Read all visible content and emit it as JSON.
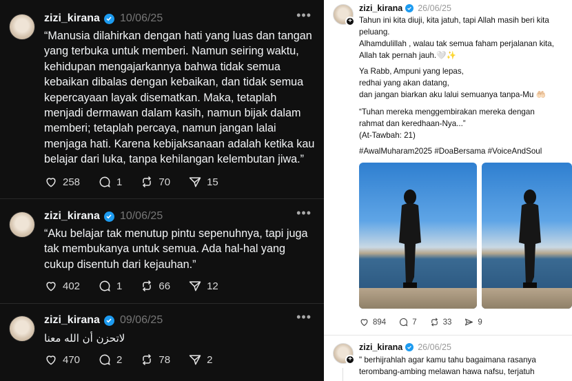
{
  "left_feed": {
    "posts": [
      {
        "username": "zizi_kirana",
        "date": "10/06/25",
        "text_lines": [
          "“Manusia dilahirkan dengan hati yang luas dan tangan",
          "yang terbuka untuk memberi. Namun seiring waktu,",
          "kehidupan mengajarkannya bahwa tidak semua",
          "kebaikan dibalas dengan kebaikan, dan tidak semua",
          "kepercayaan layak disematkan. Maka, tetaplah",
          "menjadi dermawan dalam kasih, namun bijak dalam",
          "memberi; tetaplah percaya, namun jangan lalai",
          "menjaga hati. Karena kebijaksanaan adalah ketika kau",
          "belajar dari luka, tanpa kehilangan kelembutan jiwa.”"
        ],
        "likes": "258",
        "replies": "1",
        "reposts": "70",
        "shares": "15"
      },
      {
        "username": "zizi_kirana",
        "date": "10/06/25",
        "text_lines": [
          "“Aku belajar tak menutup pintu sepenuhnya, tapi juga",
          "tak membukanya untuk semua. Ada hal-hal yang",
          "cukup disentuh dari kejauhan.”"
        ],
        "likes": "402",
        "replies": "1",
        "reposts": "66",
        "shares": "12"
      },
      {
        "username": "zizi_kirana",
        "date": "09/06/25",
        "text_lines": [
          "لاتحزن أن الله معنا"
        ],
        "likes": "470",
        "replies": "2",
        "reposts": "78",
        "shares": "2"
      }
    ],
    "more_glyph": "•••"
  },
  "right_feed": {
    "posts": [
      {
        "username": "zizi_kirana",
        "date": "26/06/25",
        "paragraphs": [
          "Tahun ini kita diuji, kita jatuh, tapi Allah masih beri kita peluang.",
          "Alhamdulillah , walau tak semua faham perjalanan kita, Allah tak pernah jauh.🤍✨",
          "Ya Rabb, Ampuni yang lepas,\nredhai yang akan datang,\ndan jangan biarkan aku lalui semuanya tanpa-Mu 🤲🏻",
          "“Tuhan mereka menggembirakan mereka dengan rahmat dan keredhaan-Nya...”\n(At-Tawbah: 21)",
          "#AwalMuharam2025 #DoaBersama #VoiceAndSoul"
        ],
        "likes": "894",
        "replies": "7",
        "reposts": "33",
        "shares": "9"
      },
      {
        "username": "zizi_kirana",
        "date": "26/06/25",
        "paragraphs": [
          "\" berhijrahlah agar kamu tahu bagaimana rasanya terombang-ambing melawan hawa nafsu, terjatuh"
        ]
      }
    ]
  },
  "colors": {
    "dark_bg": "#101010",
    "verified_blue": "#1d9bf0",
    "hashtag": "#101010"
  },
  "icons": [
    "heart-icon",
    "comment-icon",
    "repost-icon",
    "share-icon",
    "verified-badge-icon",
    "more-icon",
    "follow-plus-icon"
  ]
}
